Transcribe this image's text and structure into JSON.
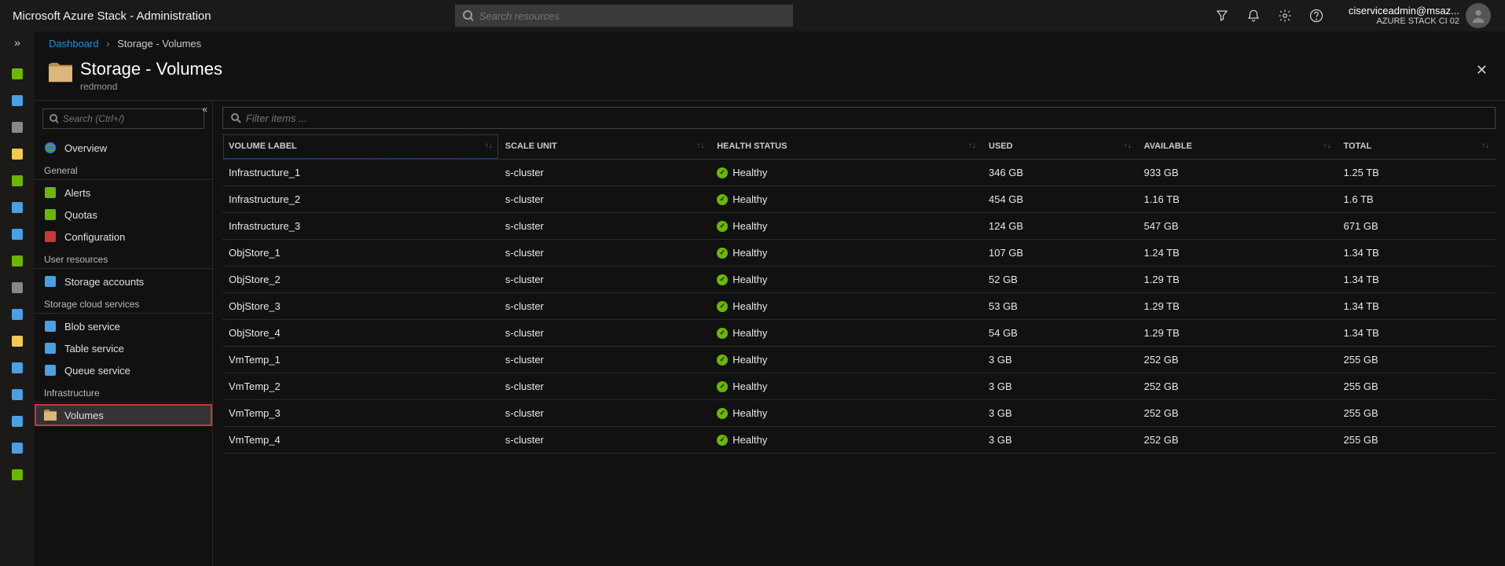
{
  "header": {
    "title": "Microsoft Azure Stack - Administration",
    "search_placeholder": "Search resources",
    "user_name": "ciserviceadmin@msaz...",
    "tenant": "AZURE STACK CI 02"
  },
  "breadcrumb": {
    "root": "Dashboard",
    "current": "Storage - Volumes"
  },
  "blade": {
    "title": "Storage - Volumes",
    "subtitle": "redmond",
    "sidebar_search_placeholder": "Search (Ctrl+/)",
    "filter_placeholder": "Filter items ..."
  },
  "sidebar": {
    "overview": "Overview",
    "groups": [
      {
        "label": "General",
        "items": [
          {
            "label": "Alerts",
            "icon": "alert",
            "color": "#6bb700"
          },
          {
            "label": "Quotas",
            "icon": "quota",
            "color": "#6bb700"
          },
          {
            "label": "Configuration",
            "icon": "config",
            "color": "#d13438"
          }
        ]
      },
      {
        "label": "User resources",
        "items": [
          {
            "label": "Storage accounts",
            "icon": "storage",
            "color": "#4aa0e0"
          }
        ]
      },
      {
        "label": "Storage cloud services",
        "items": [
          {
            "label": "Blob service",
            "icon": "service",
            "color": "#4aa0e0"
          },
          {
            "label": "Table service",
            "icon": "service",
            "color": "#4aa0e0"
          },
          {
            "label": "Queue service",
            "icon": "service",
            "color": "#4aa0e0"
          }
        ]
      },
      {
        "label": "Infrastructure",
        "items": [
          {
            "label": "Volumes",
            "icon": "folder",
            "color": "#dcb67a",
            "selected": true
          }
        ]
      }
    ]
  },
  "table": {
    "columns": [
      "VOLUME LABEL",
      "SCALE UNIT",
      "HEALTH STATUS",
      "USED",
      "AVAILABLE",
      "TOTAL"
    ],
    "rows": [
      {
        "label": "Infrastructure_1",
        "unit": "s-cluster",
        "health": "Healthy",
        "used": "346 GB",
        "avail": "933 GB",
        "total": "1.25 TB"
      },
      {
        "label": "Infrastructure_2",
        "unit": "s-cluster",
        "health": "Healthy",
        "used": "454 GB",
        "avail": "1.16 TB",
        "total": "1.6 TB"
      },
      {
        "label": "Infrastructure_3",
        "unit": "s-cluster",
        "health": "Healthy",
        "used": "124 GB",
        "avail": "547 GB",
        "total": "671 GB"
      },
      {
        "label": "ObjStore_1",
        "unit": "s-cluster",
        "health": "Healthy",
        "used": "107 GB",
        "avail": "1.24 TB",
        "total": "1.34 TB"
      },
      {
        "label": "ObjStore_2",
        "unit": "s-cluster",
        "health": "Healthy",
        "used": "52 GB",
        "avail": "1.29 TB",
        "total": "1.34 TB"
      },
      {
        "label": "ObjStore_3",
        "unit": "s-cluster",
        "health": "Healthy",
        "used": "53 GB",
        "avail": "1.29 TB",
        "total": "1.34 TB"
      },
      {
        "label": "ObjStore_4",
        "unit": "s-cluster",
        "health": "Healthy",
        "used": "54 GB",
        "avail": "1.29 TB",
        "total": "1.34 TB"
      },
      {
        "label": "VmTemp_1",
        "unit": "s-cluster",
        "health": "Healthy",
        "used": "3 GB",
        "avail": "252 GB",
        "total": "255 GB"
      },
      {
        "label": "VmTemp_2",
        "unit": "s-cluster",
        "health": "Healthy",
        "used": "3 GB",
        "avail": "252 GB",
        "total": "255 GB"
      },
      {
        "label": "VmTemp_3",
        "unit": "s-cluster",
        "health": "Healthy",
        "used": "3 GB",
        "avail": "252 GB",
        "total": "255 GB"
      },
      {
        "label": "VmTemp_4",
        "unit": "s-cluster",
        "health": "Healthy",
        "used": "3 GB",
        "avail": "252 GB",
        "total": "255 GB"
      }
    ]
  },
  "iconrail": [
    {
      "name": "plus",
      "color": "#6bb700"
    },
    {
      "name": "dashboard",
      "color": "#4aa0e0"
    },
    {
      "name": "list",
      "color": "#888"
    },
    {
      "name": "star",
      "color": "#f2c94c"
    },
    {
      "name": "grid",
      "color": "#6bb700"
    },
    {
      "name": "cube",
      "color": "#4aa0e0"
    },
    {
      "name": "monitor",
      "color": "#4aa0e0"
    },
    {
      "name": "diamond",
      "color": "#6bb700"
    },
    {
      "name": "box",
      "color": "#888"
    },
    {
      "name": "code",
      "color": "#4aa0e0"
    },
    {
      "name": "clock",
      "color": "#f2c94c"
    },
    {
      "name": "list2",
      "color": "#4aa0e0"
    },
    {
      "name": "tag",
      "color": "#4aa0e0"
    },
    {
      "name": "db",
      "color": "#4aa0e0"
    },
    {
      "name": "time",
      "color": "#4aa0e0"
    },
    {
      "name": "box2",
      "color": "#6bb700"
    }
  ]
}
